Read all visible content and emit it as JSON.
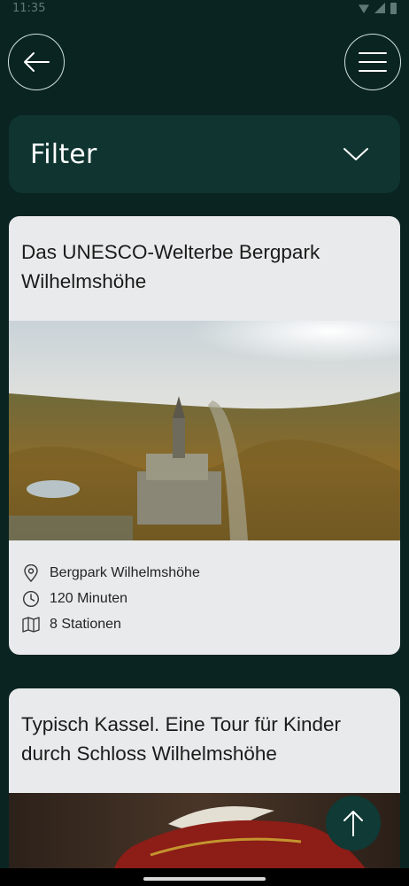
{
  "status_bar": {
    "time": "11:35"
  },
  "header": {
    "back_icon": "arrow-left-icon",
    "menu_icon": "hamburger-menu-icon"
  },
  "filter": {
    "label": "Filter",
    "icon": "chevron-down-icon"
  },
  "tours": [
    {
      "title": "Das UNESCO-Welterbe Bergpark Wilhelmshöhe",
      "location": "Bergpark Wilhelmshöhe",
      "duration": "120 Minuten",
      "stations": "8 Stationen"
    },
    {
      "title": "Typisch Kassel. Eine Tour für Kinder durch Schloss Wilhelmshöhe"
    }
  ],
  "scroll_top": {
    "icon": "arrow-up-icon"
  },
  "colors": {
    "background": "#0a2422",
    "panel": "#103531",
    "card": "#e9eaeb",
    "button": "#0f3a35"
  }
}
